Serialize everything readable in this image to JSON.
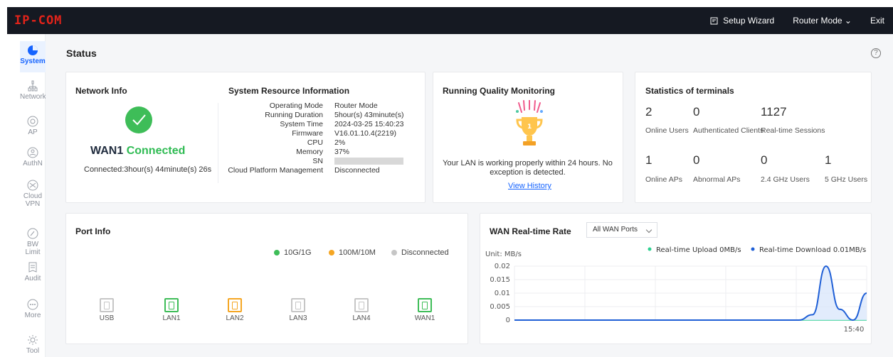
{
  "topbar": {
    "logo": "IP-COM",
    "setup_wizard": "Setup Wizard",
    "router_mode": "Router Mode",
    "exit": "Exit"
  },
  "sidebar": {
    "items": [
      {
        "label": "System",
        "icon": "pie-chart-icon",
        "active": true
      },
      {
        "label": "Network",
        "icon": "network-icon"
      },
      {
        "label": "AP",
        "icon": "ap-icon"
      },
      {
        "label": "AuthN",
        "icon": "auth-icon"
      },
      {
        "label": "Cloud VPN",
        "icon": "cloud-vpn-icon"
      },
      {
        "label": "BW Limit",
        "icon": "bandwidth-icon"
      },
      {
        "label": "Audit",
        "icon": "audit-icon"
      },
      {
        "label": "More",
        "icon": "more-icon"
      },
      {
        "label": "Tool",
        "icon": "tool-icon"
      }
    ]
  },
  "page": {
    "title": "Status",
    "help": "?"
  },
  "network_info": {
    "title": "Network Info",
    "wan_name": "WAN1",
    "wan_state": "Connected",
    "connected_time": "Connected:3hour(s) 44minute(s) 26s",
    "status_color": "#3ebd58"
  },
  "system_resources": {
    "title": "System Resource Information",
    "rows": [
      {
        "key": "Operating Mode",
        "value": "Router Mode"
      },
      {
        "key": "Running Duration",
        "value": "5hour(s) 43minute(s)"
      },
      {
        "key": "System Time",
        "value": "2024-03-25 15:40:23"
      },
      {
        "key": "Firmware",
        "value": "V16.01.10.4(2219)"
      },
      {
        "key": "CPU",
        "value": "2%"
      },
      {
        "key": "Memory",
        "value": "37%"
      },
      {
        "key": "SN",
        "value": ""
      },
      {
        "key": "Cloud Platform Management",
        "value": "Disconnected"
      }
    ]
  },
  "quality": {
    "title": "Running Quality Monitoring",
    "message": "Your LAN is working properly within 24 hours. No exception is detected.",
    "history_link": "View History"
  },
  "terminals": {
    "title": "Statistics of terminals",
    "top": [
      {
        "value": "2",
        "label": "Online Users"
      },
      {
        "value": "0",
        "label": "Authenticated Clients"
      },
      {
        "value": "1127",
        "label": "Real-time Sessions"
      }
    ],
    "bottom": [
      {
        "value": "1",
        "label": "Online APs"
      },
      {
        "value": "0",
        "label": "Abnormal APs"
      },
      {
        "value": "0",
        "label": "2.4 GHz Users"
      },
      {
        "value": "1",
        "label": "5 GHz Users"
      }
    ]
  },
  "ports": {
    "title": "Port Info",
    "legend": [
      {
        "label": "10G/1G",
        "color": "#3ebd58"
      },
      {
        "label": "100M/10M",
        "color": "#f5a623"
      },
      {
        "label": "Disconnected",
        "color": "#c6c6c6"
      }
    ],
    "items": [
      {
        "label": "USB",
        "color": "#c6c6c6"
      },
      {
        "label": "LAN1",
        "color": "#3ebd58"
      },
      {
        "label": "LAN2",
        "color": "#f5a623"
      },
      {
        "label": "LAN3",
        "color": "#c6c6c6"
      },
      {
        "label": "LAN4",
        "color": "#c6c6c6"
      },
      {
        "label": "WAN1",
        "color": "#3ebd58"
      }
    ]
  },
  "wan_rate": {
    "title": "WAN Real-time Rate",
    "selector": "All WAN Ports",
    "legend_upload": "Real-time Upload 0MB/s",
    "legend_download": "Real-time Download 0.01MB/s",
    "upload_color": "#2ed191",
    "download_color": "#1f5fd6",
    "unit": "Unit: MB/s",
    "y_ticks": [
      "0.02",
      "0.015",
      "0.01",
      "0.005",
      "0"
    ],
    "x_label": "15:40"
  },
  "chart_data": {
    "type": "line",
    "title": "WAN Real-time Rate",
    "ylabel": "Unit: MB/s",
    "ylim": [
      0,
      0.02
    ],
    "grid": true,
    "legend": "top-right",
    "x": [
      "",
      "",
      "",
      "",
      "",
      "",
      "",
      "",
      "",
      "",
      "",
      "",
      "",
      "",
      "",
      "",
      "",
      "",
      "",
      "",
      "",
      "",
      "",
      "",
      "",
      "",
      "15:40"
    ],
    "series": [
      {
        "name": "Real-time Upload 0MB/s",
        "values": [
          0,
          0,
          0,
          0,
          0,
          0,
          0,
          0,
          0,
          0,
          0,
          0,
          0,
          0,
          0,
          0,
          0,
          0,
          0,
          0,
          0,
          0,
          0,
          0,
          0,
          0,
          0
        ]
      },
      {
        "name": "Real-time Download 0.01MB/s",
        "values": [
          0,
          0,
          0,
          0,
          0,
          0,
          0,
          0,
          0,
          0,
          0,
          0,
          0,
          0,
          0,
          0,
          0,
          0,
          0,
          0,
          0,
          0,
          0.002,
          0.02,
          0.004,
          0,
          0.01
        ]
      }
    ]
  }
}
